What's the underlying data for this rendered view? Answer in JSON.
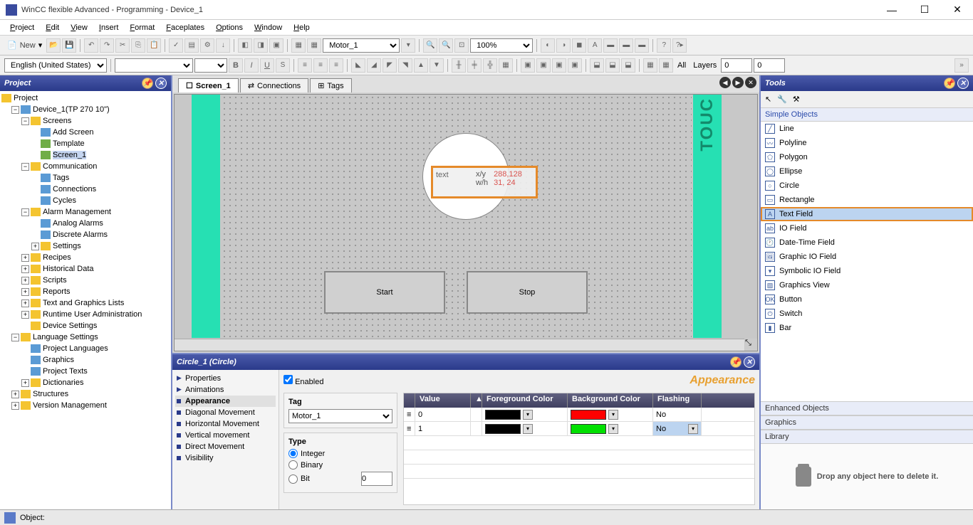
{
  "window": {
    "title": "WinCC flexible Advanced - Programming - Device_1"
  },
  "menu": [
    "Project",
    "Edit",
    "View",
    "Insert",
    "Format",
    "Faceplates",
    "Options",
    "Window",
    "Help"
  ],
  "toolbar1": {
    "new_label": "New",
    "motor_combo": "Motor_1",
    "zoom": "100%"
  },
  "toolbar2": {
    "lang": "English (United States)",
    "layers_label": "Layers",
    "all_label": "All",
    "coord1": "0",
    "coord2": "0"
  },
  "project_panel": {
    "title": "Project",
    "tree": {
      "root": "Project",
      "device": "Device_1(TP 270 10\")",
      "screens": "Screens",
      "add_screen": "Add Screen",
      "template": "Template",
      "screen1": "Screen_1",
      "communication": "Communication",
      "tags": "Tags",
      "connections": "Connections",
      "cycles": "Cycles",
      "alarm_mgmt": "Alarm Management",
      "analog": "Analog Alarms",
      "discrete": "Discrete Alarms",
      "settings": "Settings",
      "recipes": "Recipes",
      "historical": "Historical Data",
      "scripts": "Scripts",
      "reports": "Reports",
      "textgfx": "Text and Graphics Lists",
      "runtime": "Runtime User Administration",
      "devset": "Device Settings",
      "lang_set": "Language Settings",
      "proj_lang": "Project Languages",
      "graphics": "Graphics",
      "proj_texts": "Project Texts",
      "dict": "Dictionaries",
      "structures": "Structures",
      "version": "Version Management"
    }
  },
  "editor_tabs": {
    "screen": "Screen_1",
    "connections": "Connections",
    "tags": "Tags"
  },
  "canvas": {
    "text_label": "text",
    "xy_key": "x/y",
    "xy_val": "288,128",
    "wh_key": "w/h",
    "wh_val": "31, 24",
    "start": "Start",
    "stop": "Stop",
    "touch": "TOUC"
  },
  "props": {
    "header": "Circle_1 (Circle)",
    "cats": {
      "properties": "Properties",
      "animations": "Animations",
      "appearance": "Appearance",
      "diag": "Diagonal Movement",
      "horiz": "Horizontal Movement",
      "vert": "Vertical movement",
      "direct": "Direct Movement",
      "visibility": "Visibility"
    },
    "enabled": "Enabled",
    "title": "Appearance",
    "tag_group": "Tag",
    "tag_val": "Motor_1",
    "type_group": "Type",
    "type_int": "Integer",
    "type_bin": "Binary",
    "type_bit": "Bit",
    "bit_val": "0",
    "cols": {
      "value": "Value",
      "fg": "Foreground Color",
      "bg": "Background Color",
      "flash": "Flashing"
    },
    "rows": [
      {
        "value": "0",
        "fg": "#000000",
        "bg": "#ff0000",
        "flash": "No"
      },
      {
        "value": "1",
        "fg": "#000000",
        "bg": "#00e000",
        "flash": "No"
      }
    ]
  },
  "tools": {
    "title": "Tools",
    "simple": "Simple Objects",
    "items": {
      "line": "Line",
      "polyline": "Polyline",
      "polygon": "Polygon",
      "ellipse": "Ellipse",
      "circle": "Circle",
      "rectangle": "Rectangle",
      "textfield": "Text Field",
      "iofield": "IO Field",
      "datetime": "Date-Time Field",
      "gio": "Graphic IO Field",
      "sio": "Symbolic IO Field",
      "gview": "Graphics View",
      "button": "Button",
      "switch": "Switch",
      "bar": "Bar"
    },
    "enhanced": "Enhanced Objects",
    "graphics": "Graphics",
    "library": "Library",
    "drop_hint": "Drop any object here to delete it."
  },
  "status": {
    "object": "Object:"
  }
}
